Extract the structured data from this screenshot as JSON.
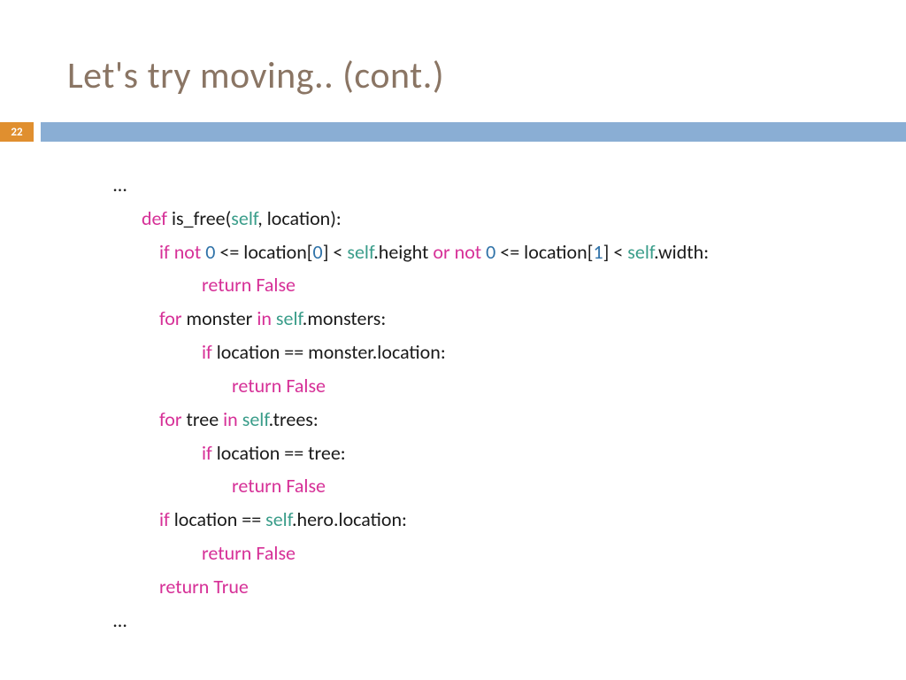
{
  "title": "Let's try moving.. (cont.)",
  "page_number": "22",
  "code": {
    "ellipsis_top": "…",
    "line1": {
      "def": "def",
      "fn": " is_free(",
      "self": "self",
      "rest": ", location):"
    },
    "line2": {
      "if": "if",
      "not": " not ",
      "zero1": "0",
      "cmp1": " <= location[",
      "idx0": "0",
      "cmp2": "] < ",
      "self1": "self",
      "height": ".height ",
      "or": "or",
      "not2": " not ",
      "zero2": "0",
      "cmp3": " <= location[",
      "idx1": "1",
      "cmp4": "] < ",
      "self2": "self",
      "width": ".width:"
    },
    "line3": {
      "return": "return",
      "val": " False"
    },
    "line4": {
      "for": "for",
      "var": " monster ",
      "in": "in ",
      "self": "self",
      "rest": ".monsters:"
    },
    "line5": {
      "if": "if",
      "rest": " location == monster.location:"
    },
    "line6": {
      "return": "return",
      "val": " False"
    },
    "line7": {
      "for": "for",
      "var": " tree ",
      "in": "in ",
      "self": "self",
      "rest": ".trees:"
    },
    "line8": {
      "if": "if",
      "rest": " location == tree:"
    },
    "line9": {
      "return": "return",
      "val": " False"
    },
    "line10": {
      "if": "if",
      "txt1": " location == ",
      "self": "self",
      "rest": ".hero.location:"
    },
    "line11": {
      "return": "return",
      "val": " False"
    },
    "line12": {
      "return": "return",
      "val": " True"
    },
    "ellipsis_bottom": "…"
  }
}
